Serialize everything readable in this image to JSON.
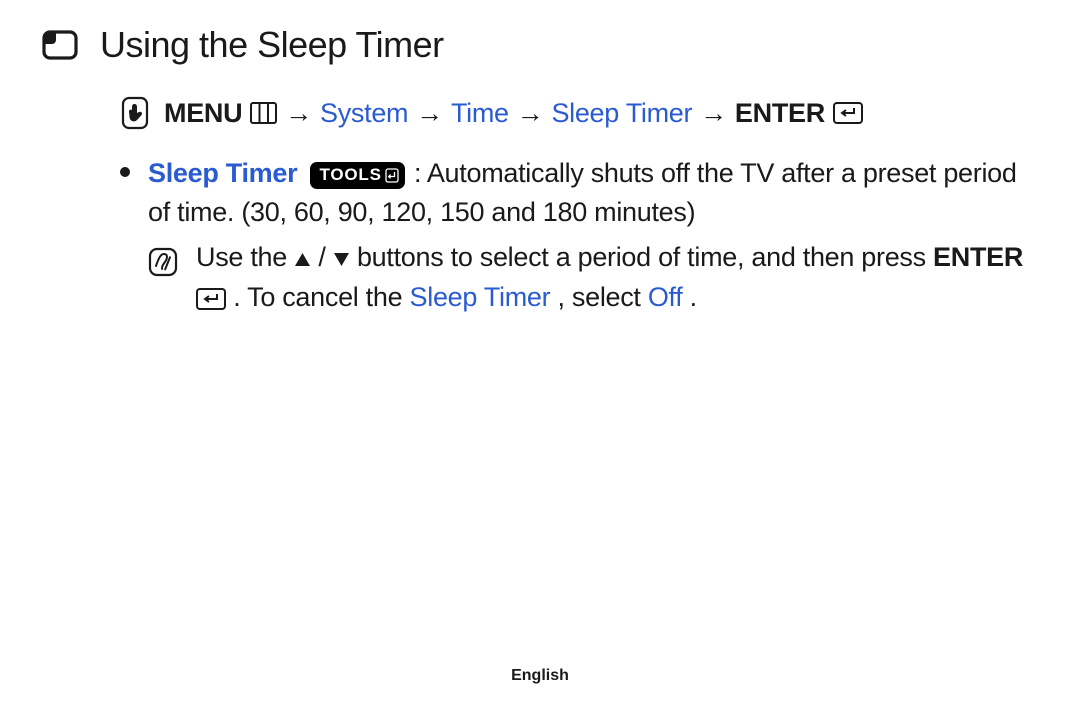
{
  "title": "Using the Sleep Timer",
  "path": {
    "menu_label": "MENU",
    "system": "System",
    "time": "Time",
    "sleep_timer": "Sleep Timer",
    "enter_label": "ENTER",
    "arrow": "→"
  },
  "bullet": {
    "feature_name": "Sleep Timer",
    "tools_badge": "TOOLS",
    "text_after_colon": ": Automatically shuts off the TV after a preset period of time. (30, 60, 90, 120, 150 and 180 minutes)"
  },
  "note": {
    "pre": "Use the ",
    "slash": "/",
    "mid1": " buttons to select a period of time, and then press ",
    "enter_label": "ENTER",
    "mid2": ". To cancel the ",
    "sleep_timer_link": "Sleep Timer",
    "mid3": ", select ",
    "off_link": "Off",
    "period": "."
  },
  "footer": "English"
}
